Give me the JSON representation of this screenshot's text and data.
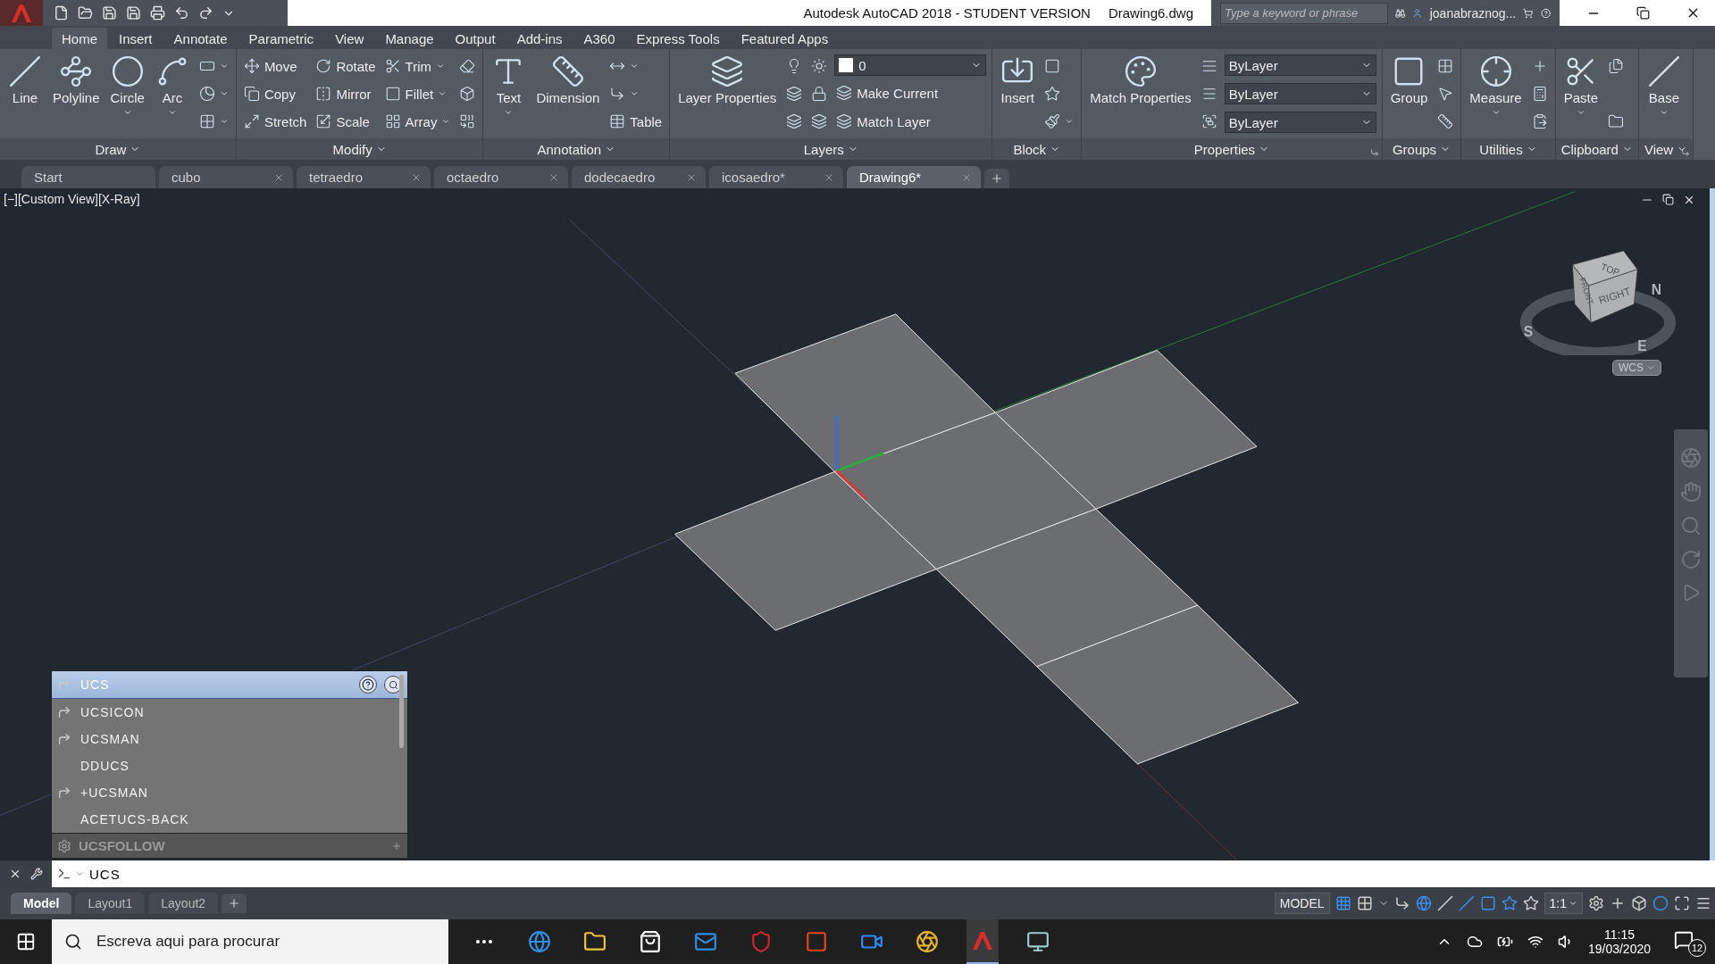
{
  "title_bar": {
    "app_title": "Autodesk AutoCAD 2018 - STUDENT VERSION",
    "file_name": "Drawing6.dwg",
    "search": {
      "placeholder": "Type a keyword or phrase"
    },
    "user": "joanabraznog..."
  },
  "menu_tabs": [
    {
      "label": "Home",
      "selected": true
    },
    {
      "label": "Insert",
      "selected": false
    },
    {
      "label": "Annotate",
      "selected": false
    },
    {
      "label": "Parametric",
      "selected": false
    },
    {
      "label": "View",
      "selected": false
    },
    {
      "label": "Manage",
      "selected": false
    },
    {
      "label": "Output",
      "selected": false
    },
    {
      "label": "Add-ins",
      "selected": false
    },
    {
      "label": "A360",
      "selected": false
    },
    {
      "label": "Express Tools",
      "selected": false
    },
    {
      "label": "Featured Apps",
      "selected": false
    }
  ],
  "ribbon": [
    {
      "title": "Draw",
      "launcher": false,
      "groups": [
        {
          "kind": "large",
          "label": "Line",
          "menu": false
        },
        {
          "kind": "large",
          "label": "Polyline",
          "menu": false
        },
        {
          "kind": "large",
          "label": "Circle",
          "menu": true
        },
        {
          "kind": "large",
          "label": "Arc",
          "menu": true
        },
        {
          "kind": "column",
          "items": [
            {
              "kind": "tool",
              "menu": true
            },
            {
              "kind": "tool",
              "menu": true
            },
            {
              "kind": "tool",
              "menu": true
            }
          ]
        }
      ]
    },
    {
      "title": "Modify",
      "launcher": false,
      "groups": [
        {
          "kind": "column",
          "items": [
            {
              "kind": "tool",
              "label": "Move",
              "menu": false
            },
            {
              "kind": "tool",
              "label": "Copy",
              "menu": false
            },
            {
              "kind": "tool",
              "label": "Stretch",
              "menu": false
            }
          ]
        },
        {
          "kind": "column",
          "items": [
            {
              "kind": "tool",
              "label": "Rotate",
              "menu": false
            },
            {
              "kind": "tool",
              "label": "Mirror",
              "menu": false
            },
            {
              "kind": "tool",
              "label": "Scale",
              "menu": false
            }
          ]
        },
        {
          "kind": "column",
          "items": [
            {
              "kind": "tool",
              "label": "Trim",
              "menu": true
            },
            {
              "kind": "tool",
              "label": "Fillet",
              "menu": true
            },
            {
              "kind": "tool",
              "label": "Array",
              "menu": true
            }
          ]
        },
        {
          "kind": "column",
          "items": [
            {
              "kind": "tool",
              "menu": false
            },
            {
              "kind": "tool",
              "menu": false
            },
            {
              "kind": "tool",
              "menu": false
            }
          ]
        }
      ]
    },
    {
      "title": "Annotation",
      "launcher": false,
      "groups": [
        {
          "kind": "large",
          "label": "Text",
          "menu": true
        },
        {
          "kind": "large",
          "label": "Dimension",
          "menu": false
        },
        {
          "kind": "column",
          "items": [
            {
              "kind": "tool",
              "menu": true
            },
            {
              "kind": "tool",
              "menu": true
            },
            {
              "kind": "tool",
              "label": "Table",
              "menu": false
            }
          ]
        }
      ]
    },
    {
      "title": "Layers",
      "launcher": false,
      "groups": [
        {
          "kind": "large",
          "label": "Layer Properties",
          "menu": false
        },
        {
          "kind": "column",
          "items": [
            {
              "kind": "tool",
              "menu": false
            },
            {
              "kind": "tool",
              "menu": false
            },
            {
              "kind": "tool",
              "menu": false
            }
          ]
        },
        {
          "kind": "column",
          "items": [
            {
              "kind": "tool",
              "menu": false
            },
            {
              "kind": "tool",
              "menu": false
            },
            {
              "kind": "tool",
              "menu": false
            }
          ]
        },
        {
          "kind": "column",
          "items": [
            {
              "kind": "select",
              "value": "0"
            },
            {
              "kind": "tool",
              "label": "Make Current",
              "menu": false
            },
            {
              "kind": "tool",
              "label": "Match Layer",
              "menu": false
            }
          ]
        }
      ]
    },
    {
      "title": "Block",
      "launcher": false,
      "groups": [
        {
          "kind": "large",
          "label": "Insert",
          "menu": false
        },
        {
          "kind": "column",
          "items": [
            {
              "kind": "tool",
              "menu": false
            },
            {
              "kind": "tool",
              "menu": false
            },
            {
              "kind": "tool",
              "menu": true
            }
          ]
        }
      ]
    },
    {
      "title": "Properties",
      "launcher": true,
      "groups": [
        {
          "kind": "large",
          "label": "Match Properties",
          "menu": false
        },
        {
          "kind": "column",
          "items": [
            {
              "kind": "tool",
              "menu": false
            },
            {
              "kind": "tool",
              "menu": false
            },
            {
              "kind": "tool",
              "menu": false
            }
          ]
        },
        {
          "kind": "column",
          "items": [
            {
              "kind": "select",
              "value": "ByLayer"
            },
            {
              "kind": "select",
              "value": "ByLayer"
            },
            {
              "kind": "select",
              "value": "ByLayer"
            }
          ]
        }
      ]
    },
    {
      "title": "Groups",
      "launcher": false,
      "groups": [
        {
          "kind": "large",
          "label": "Group",
          "menu": false
        },
        {
          "kind": "column",
          "items": [
            {
              "kind": "tool",
              "menu": false
            },
            {
              "kind": "tool",
              "menu": false
            },
            {
              "kind": "tool",
              "menu": false
            }
          ]
        }
      ]
    },
    {
      "title": "Utilities",
      "launcher": false,
      "groups": [
        {
          "kind": "large",
          "label": "Measure",
          "menu": true
        },
        {
          "kind": "column",
          "items": [
            {
              "kind": "tool",
              "menu": false
            },
            {
              "kind": "tool",
              "menu": false
            },
            {
              "kind": "tool",
              "menu": false
            }
          ]
        }
      ]
    },
    {
      "title": "Clipboard",
      "launcher": false,
      "groups": [
        {
          "kind": "large",
          "label": "Paste",
          "menu": true
        },
        {
          "kind": "column",
          "items": [
            {
              "kind": "tool",
              "menu": false
            },
            {
              "kind": "tool",
              "menu": false
            }
          ]
        }
      ]
    },
    {
      "title": "View",
      "launcher": true,
      "groups": [
        {
          "kind": "large",
          "label": "Base",
          "menu": true
        }
      ]
    }
  ],
  "file_tabs": [
    {
      "label": "Start",
      "selected": false,
      "closable": false
    },
    {
      "label": "cubo",
      "selected": false,
      "closable": true
    },
    {
      "label": "tetraedro",
      "selected": false,
      "closable": true
    },
    {
      "label": "octaedro",
      "selected": false,
      "closable": true
    },
    {
      "label": "dodecaedro",
      "selected": false,
      "closable": true
    },
    {
      "label": "icosaedro*",
      "selected": false,
      "closable": true
    },
    {
      "label": "Drawing6*",
      "selected": true,
      "closable": true
    }
  ],
  "viewport": {
    "label": "[−][Custom View][X-Ray]",
    "view_cube": {
      "top": "TOP",
      "front": "FRONT",
      "right": "RIGHT",
      "north": "N",
      "south": "S",
      "east": "E",
      "ucs": "WCS"
    }
  },
  "autocomplete": {
    "items": [
      {
        "label": "UCS",
        "kind": "icon",
        "selected": true
      },
      {
        "label": "UCSICON",
        "kind": "icon",
        "selected": false
      },
      {
        "label": "UCSMAN",
        "kind": "icon",
        "selected": false
      },
      {
        "label": "DDUCS",
        "kind": "plain",
        "selected": false
      },
      {
        "label": "+UCSMAN",
        "kind": "icon",
        "selected": false
      },
      {
        "label": "ACETUCS-BACK",
        "kind": "plain",
        "selected": false
      }
    ],
    "footer": "UCSFOLLOW"
  },
  "command_line": {
    "value": "UCS"
  },
  "layout_tabs": [
    {
      "label": "Model",
      "selected": true
    },
    {
      "label": "Layout1",
      "selected": false
    },
    {
      "label": "Layout2",
      "selected": false
    }
  ],
  "status_bar": {
    "space": "MODEL",
    "scale": "1:1"
  },
  "taskbar": {
    "search": {
      "placeholder": "Escreva aqui para procurar"
    },
    "time": "11:15",
    "date": "19/03/2020",
    "notifications": "12"
  }
}
